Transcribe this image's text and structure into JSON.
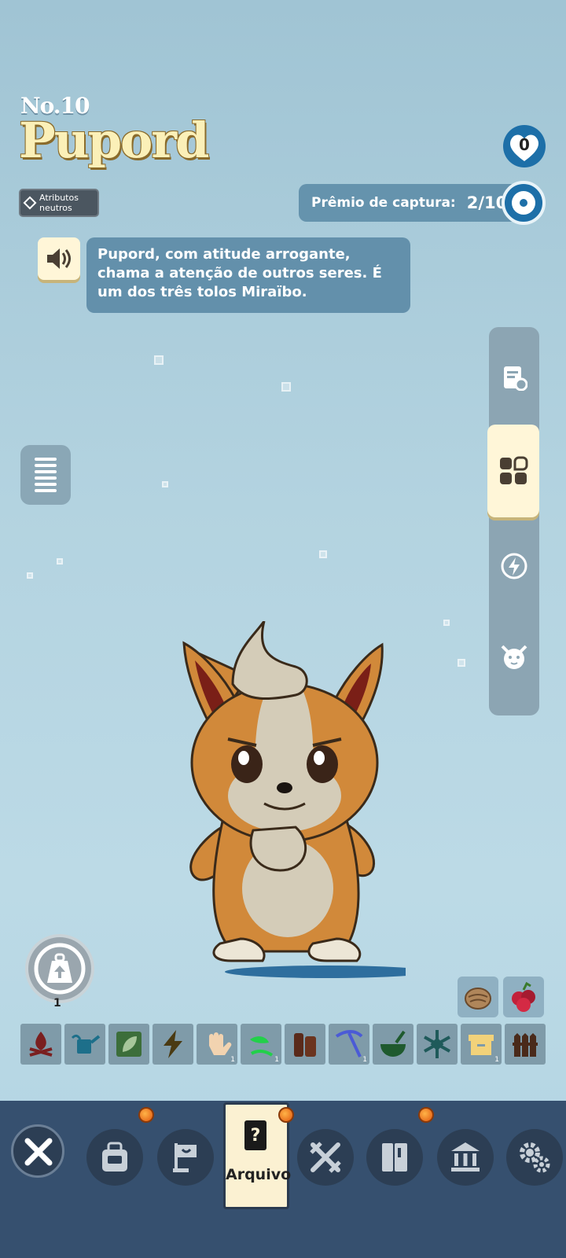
{
  "header": {
    "number": "No.10",
    "name": "Pupord",
    "attribute_line1": "Atributos",
    "attribute_line2": "neutros",
    "heart_count": "0"
  },
  "capture": {
    "label": "Prêmio de captura:",
    "value": "2/10"
  },
  "description": "Pupord, com atitude arrogante, chama a atenção de outros seres. É um dos três tolos Miraïbo.",
  "side_tabs": [
    "document-settings-icon",
    "grid-icon",
    "lightning-icon",
    "creature-face-icon"
  ],
  "weight": {
    "count": "1"
  },
  "drops": [
    "nut-icon",
    "berry-icon"
  ],
  "skills": [
    {
      "icon": "campfire-icon",
      "count": ""
    },
    {
      "icon": "watering-can-icon",
      "count": ""
    },
    {
      "icon": "leaf-icon",
      "count": ""
    },
    {
      "icon": "lightning-icon",
      "count": ""
    },
    {
      "icon": "hand-icon",
      "count": "1"
    },
    {
      "icon": "sprout-icon",
      "count": "1"
    },
    {
      "icon": "logs-icon",
      "count": ""
    },
    {
      "icon": "pickaxe-icon",
      "count": "1"
    },
    {
      "icon": "bowl-icon",
      "count": ""
    },
    {
      "icon": "snowflake-icon",
      "count": ""
    },
    {
      "icon": "storage-box-icon",
      "count": "1"
    },
    {
      "icon": "fence-icon",
      "count": ""
    }
  ],
  "nav": {
    "active_label": "Arquivo",
    "items": [
      "close-x-icon",
      "backpack-icon",
      "flag-icon",
      "archive-icon",
      "swords-icon",
      "book-icon",
      "museum-icon",
      "gears-icon"
    ]
  },
  "colors": {
    "name_yellow": "#fbf0b8",
    "panel_blue": "#6390ab",
    "nav_bg": "#36506f",
    "active_cream": "#fbf1d2"
  }
}
